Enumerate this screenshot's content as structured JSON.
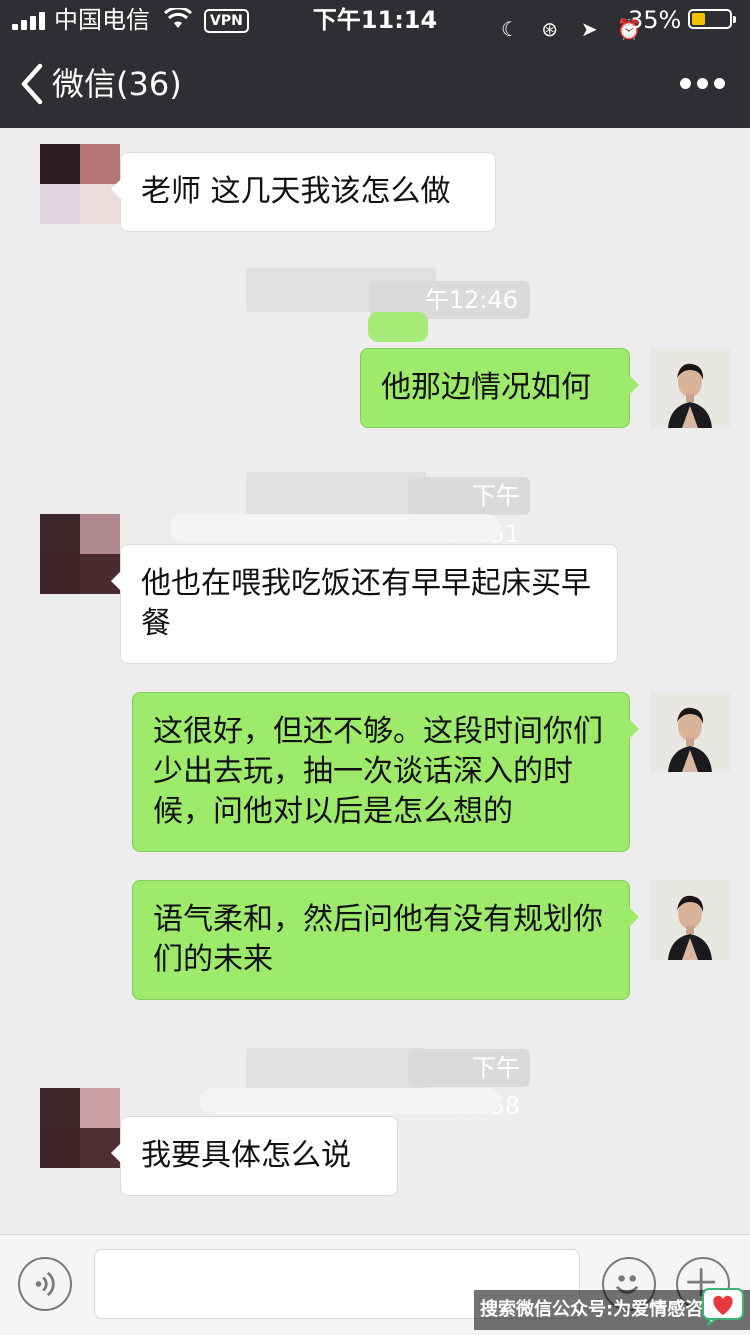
{
  "status_bar": {
    "carrier": "中国电信",
    "vpn": "VPN",
    "time": "下午11:14",
    "battery": "35%"
  },
  "nav": {
    "back_label": "微信(36)"
  },
  "messages": [
    {
      "side": "left",
      "text": "老师 这几天我该怎么做"
    },
    {
      "type": "time",
      "text": "午12:46"
    },
    {
      "side": "right",
      "text": "他那边情况如何"
    },
    {
      "type": "time",
      "text": "下午12:51"
    },
    {
      "side": "left",
      "text": "他也在喂我吃饭还有早早起床买早餐"
    },
    {
      "side": "right",
      "text": "这很好，但还不够。这段时间你们少出去玩，抽一次谈话深入的时候，问他对以后是怎么想的"
    },
    {
      "side": "right",
      "text": "语气柔和，然后问他有没有规划你们的未来"
    },
    {
      "type": "time",
      "text": "下午12:58"
    },
    {
      "side": "left",
      "text": "我要具体怎么说"
    }
  ],
  "watermark": "搜索微信公众号:为爱情感咨询"
}
